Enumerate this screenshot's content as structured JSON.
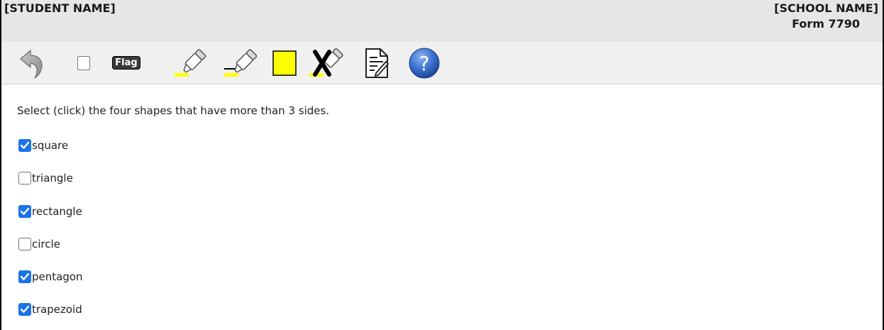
{
  "header": {
    "student_name": "[STUDENT NAME]",
    "school_name": "[SCHOOL NAME]",
    "form_number": "Form 7790"
  },
  "toolbar": {
    "flag_label": "Flag",
    "tools": [
      "undo-icon",
      "mark-checkbox",
      "flag-button",
      "highlighter-icon",
      "strikethrough-icon",
      "yellow-highlight-icon",
      "eraser-icon",
      "notes-icon",
      "help-icon"
    ],
    "highlight_color": "#ffff00"
  },
  "question": {
    "prompt": "Select (click) the four shapes that have more than 3 sides.",
    "options": [
      {
        "label": "square",
        "checked": true
      },
      {
        "label": "triangle",
        "checked": false
      },
      {
        "label": "rectangle",
        "checked": true
      },
      {
        "label": "circle",
        "checked": false
      },
      {
        "label": "pentagon",
        "checked": true
      },
      {
        "label": "trapezoid",
        "checked": true
      }
    ]
  },
  "colors": {
    "checkbox_checked": "#1a73e8",
    "header_bg": "#e6e6e6",
    "toolbar_bg": "#f0f0f0"
  }
}
